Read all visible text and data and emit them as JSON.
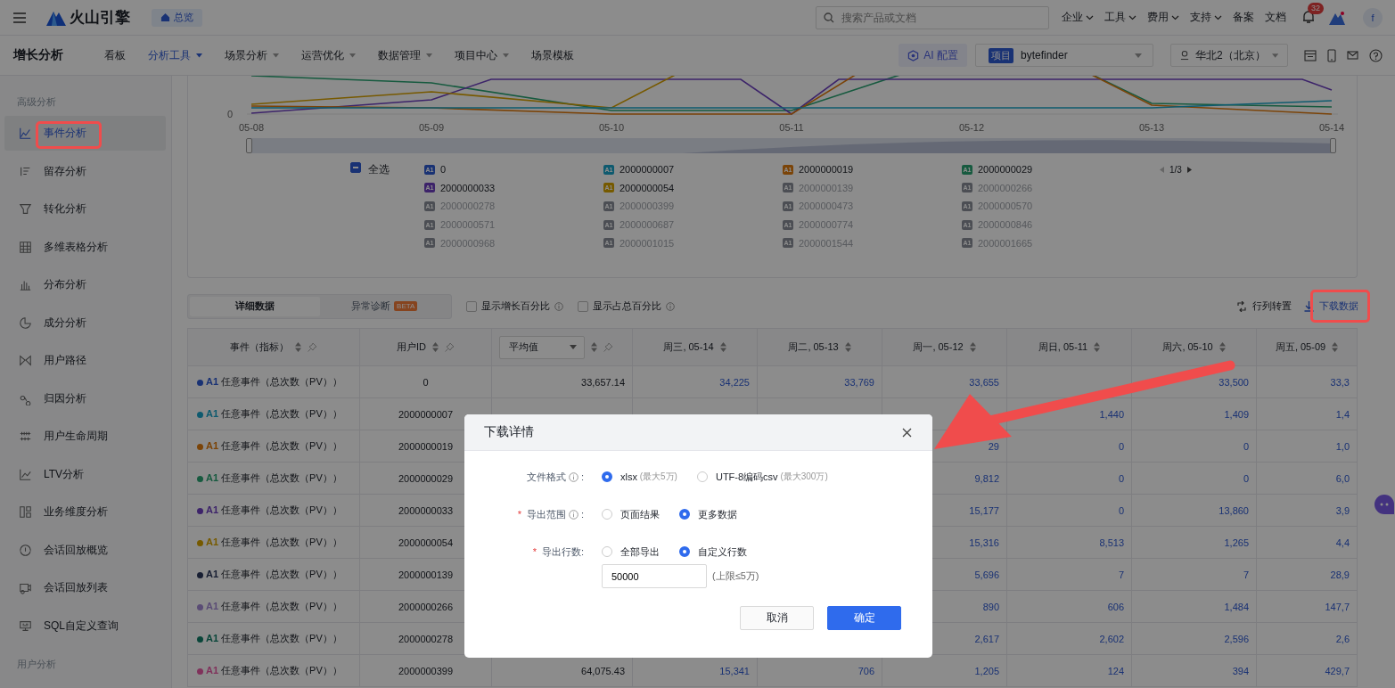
{
  "top_bar": {
    "brand": "火山引擎",
    "home_button": "总览",
    "search": {
      "placeholder": "搜索产品或文档"
    },
    "nav": [
      {
        "label": "企业",
        "dropdown": true
      },
      {
        "label": "工具",
        "dropdown": true
      },
      {
        "label": "费用",
        "dropdown": true
      },
      {
        "label": "支持",
        "dropdown": true
      },
      {
        "label": "备案",
        "dropdown": false
      },
      {
        "label": "文档",
        "dropdown": false
      }
    ],
    "notification_count": "32",
    "avatar_letter": "f"
  },
  "sub_nav": {
    "title": "增长分析",
    "tabs": [
      {
        "label": "看板",
        "selected": false,
        "dropdown": false
      },
      {
        "label": "分析工具",
        "selected": true,
        "dropdown": true
      },
      {
        "label": "场景分析",
        "selected": false,
        "dropdown": true
      },
      {
        "label": "运营优化",
        "selected": false,
        "dropdown": true
      },
      {
        "label": "数据管理",
        "selected": false,
        "dropdown": true
      },
      {
        "label": "项目中心",
        "selected": false,
        "dropdown": true
      },
      {
        "label": "场景模板",
        "selected": false,
        "dropdown": false
      }
    ],
    "ai_button": "AI 配置",
    "project": {
      "tag": "项目",
      "value": "bytefinder"
    },
    "region": "华北2（北京）"
  },
  "sidebar": {
    "items": [
      {
        "kind": "header",
        "label": "高级分析"
      },
      {
        "kind": "item",
        "label": "事件分析",
        "selected": true
      },
      {
        "kind": "item",
        "label": "留存分析",
        "selected": false
      },
      {
        "kind": "item",
        "label": "转化分析",
        "selected": false
      },
      {
        "kind": "item",
        "label": "多维表格分析",
        "selected": false
      },
      {
        "kind": "item",
        "label": "分布分析",
        "selected": false
      },
      {
        "kind": "item",
        "label": "成分分析",
        "selected": false
      },
      {
        "kind": "item",
        "label": "用户路径",
        "selected": false
      },
      {
        "kind": "item",
        "label": "归因分析",
        "selected": false
      },
      {
        "kind": "item",
        "label": "用户生命周期",
        "selected": false
      },
      {
        "kind": "item",
        "label": "LTV分析",
        "selected": false
      },
      {
        "kind": "item",
        "label": "业务维度分析",
        "selected": false
      },
      {
        "kind": "item",
        "label": "会话回放概览",
        "selected": false
      },
      {
        "kind": "item",
        "label": "会话回放列表",
        "selected": false
      },
      {
        "kind": "item",
        "label": "SQL自定义查询",
        "selected": false
      },
      {
        "kind": "header",
        "label": "用户分析"
      }
    ]
  },
  "chart": {
    "y_tick": "0",
    "x_labels": [
      "05-08",
      "05-09",
      "05-10",
      "05-11",
      "05-12",
      "05-13",
      "05-14"
    ],
    "slider": {
      "level": 1
    },
    "legend": {
      "select_all": {
        "label": "全选",
        "checked": false,
        "indeterminate": true
      },
      "pager": "1/3",
      "items": [
        {
          "tag": "A1",
          "label": "0",
          "selected": true,
          "color": "#1a3274"
        },
        {
          "tag": "A1",
          "label": "2000000007",
          "selected": true,
          "color": "#0f5b6f"
        },
        {
          "tag": "A1",
          "label": "2000000019",
          "selected": true,
          "color": "#7b4408"
        },
        {
          "tag": "A1",
          "label": "2000000029",
          "selected": true,
          "color": "#175b40"
        },
        {
          "tag": "A1",
          "label": "2000000033",
          "selected": true,
          "color": "#3d246a"
        },
        {
          "tag": "A1",
          "label": "2000000054",
          "selected": true,
          "color": "#775a00"
        },
        {
          "tag": "A1",
          "label": "2000000139",
          "selected": false
        },
        {
          "tag": "A1",
          "label": "2000000266",
          "selected": false
        },
        {
          "tag": "A1",
          "label": "2000000278",
          "selected": false
        },
        {
          "tag": "A1",
          "label": "2000000399",
          "selected": false
        },
        {
          "tag": "A1",
          "label": "2000000473",
          "selected": false
        },
        {
          "tag": "A1",
          "label": "2000000570",
          "selected": false
        },
        {
          "tag": "A1",
          "label": "2000000571",
          "selected": false
        },
        {
          "tag": "A1",
          "label": "2000000687",
          "selected": false
        },
        {
          "tag": "A1",
          "label": "2000000774",
          "selected": false
        },
        {
          "tag": "A1",
          "label": "2000000846",
          "selected": false
        },
        {
          "tag": "A1",
          "label": "2000000968",
          "selected": false
        },
        {
          "tag": "A1",
          "label": "2000001015",
          "selected": false
        },
        {
          "tag": "A1",
          "label": "2000001544",
          "selected": false
        },
        {
          "tag": "A1",
          "label": "2000001665",
          "selected": false
        }
      ]
    }
  },
  "toolbar": {
    "view_tabs": [
      {
        "label": "详细数据",
        "selected": true
      },
      {
        "label": "异常诊断",
        "badge": "BETA",
        "selected": false
      }
    ],
    "checkboxes": [
      {
        "label": "显示增长百分比",
        "checked": false
      },
      {
        "label": "显示占总百分比",
        "checked": false
      }
    ],
    "actions": [
      {
        "kind": "transpose",
        "label": "行列转置"
      },
      {
        "kind": "download",
        "label": "下载数据"
      }
    ]
  },
  "table": {
    "columns": [
      {
        "label": "事件（指标）",
        "kind": "event",
        "pin": true
      },
      {
        "label": "用户ID",
        "kind": "id",
        "pin": true
      },
      {
        "label": "平均值",
        "kind": "select",
        "pin": true
      },
      {
        "label": "周三, 05-14",
        "kind": "metric",
        "pin": false
      },
      {
        "label": "周二, 05-13",
        "kind": "metric",
        "pin": false
      },
      {
        "label": "周一, 05-12",
        "kind": "metric",
        "pin": false
      },
      {
        "label": "周日, 05-11",
        "kind": "metric",
        "pin": false
      },
      {
        "label": "周六, 05-10",
        "kind": "metric",
        "pin": false
      },
      {
        "label": "周五, 05-09",
        "kind": "metric",
        "pin": false
      }
    ],
    "rows": [
      {
        "color": "#1a3274",
        "tag": "A1",
        "cells": [
          "任意事件（总次数（PV））",
          "0",
          "33,657.14",
          "34,225",
          "33,769",
          "33,655",
          null,
          "33,500",
          "33,3"
        ]
      },
      {
        "color": "#0f5b6f",
        "tag": "A1",
        "cells": [
          "任意事件（总次数（PV））",
          "2000000007",
          null,
          null,
          null,
          null,
          "1,440",
          "1,409",
          "1,4"
        ]
      },
      {
        "color": "#7b4408",
        "tag": "A1",
        "cells": [
          "任意事件（总次数（PV））",
          "2000000019",
          null,
          null,
          null,
          "29",
          "0",
          "0",
          "1,0"
        ]
      },
      {
        "color": "#175b40",
        "tag": "A1",
        "cells": [
          "任意事件（总次数（PV））",
          "2000000029",
          null,
          null,
          null,
          "9,812",
          "0",
          "0",
          "6,0"
        ]
      },
      {
        "color": "#3d246a",
        "tag": "A1",
        "cells": [
          "任意事件（总次数（PV））",
          "2000000033",
          null,
          null,
          null,
          "15,177",
          "0",
          "13,860",
          "3,9"
        ]
      },
      {
        "color": "#775a00",
        "tag": "A1",
        "cells": [
          "任意事件（总次数（PV））",
          "2000000054",
          null,
          null,
          null,
          "15,316",
          "8,513",
          "1,265",
          "4,4"
        ]
      },
      {
        "color": "#192033",
        "tag": "A1",
        "cells": [
          "任意事件（总次数（PV））",
          "2000000139",
          null,
          null,
          null,
          "5,696",
          "7",
          "7",
          "28,9"
        ]
      },
      {
        "color": "#5a4c75",
        "tag": "A1",
        "cells": [
          "任意事件（总次数（PV））",
          "2000000266",
          null,
          null,
          null,
          "890",
          "606",
          "1,484",
          "147,7"
        ]
      },
      {
        "color": "#0a463a",
        "tag": "A1",
        "cells": [
          "任意事件（总次数（PV））",
          "2000000278",
          null,
          null,
          null,
          "2,617",
          "2,602",
          "2,596",
          "2,6"
        ]
      },
      {
        "color": "#80325c",
        "tag": "A1",
        "cells": [
          "任意事件（总次数（PV））",
          "2000000399",
          "64,075.43",
          "15,341",
          "706",
          "1,205",
          "124",
          "394",
          "429,7"
        ]
      }
    ]
  },
  "dialog": {
    "title": "下载详情",
    "fields": [
      {
        "label": "文件格式",
        "info": true,
        "suffix": " :",
        "options": [
          {
            "label": "xlsx",
            "note": "(最大5万)",
            "selected": true
          },
          {
            "label": "UTF-8编码csv",
            "note": "(最大300万)",
            "selected": false
          }
        ]
      },
      {
        "label": "导出范围",
        "required_mark": "*",
        "info": true,
        "suffix": " :",
        "options": [
          {
            "label": "页面结果",
            "selected": false
          },
          {
            "label": "更多数据",
            "selected": true
          }
        ]
      },
      {
        "label": "导出行数:",
        "required_mark": "*",
        "info": false,
        "options": [
          {
            "label": "全部导出",
            "selected": false
          },
          {
            "label": "自定义行数",
            "selected": true
          }
        ],
        "input": {
          "value": "50000",
          "hint": "(上限≤5万)"
        }
      }
    ],
    "buttons": [
      {
        "kind": "secondary",
        "label": "取消"
      },
      {
        "kind": "primary",
        "label": "确定"
      }
    ]
  }
}
